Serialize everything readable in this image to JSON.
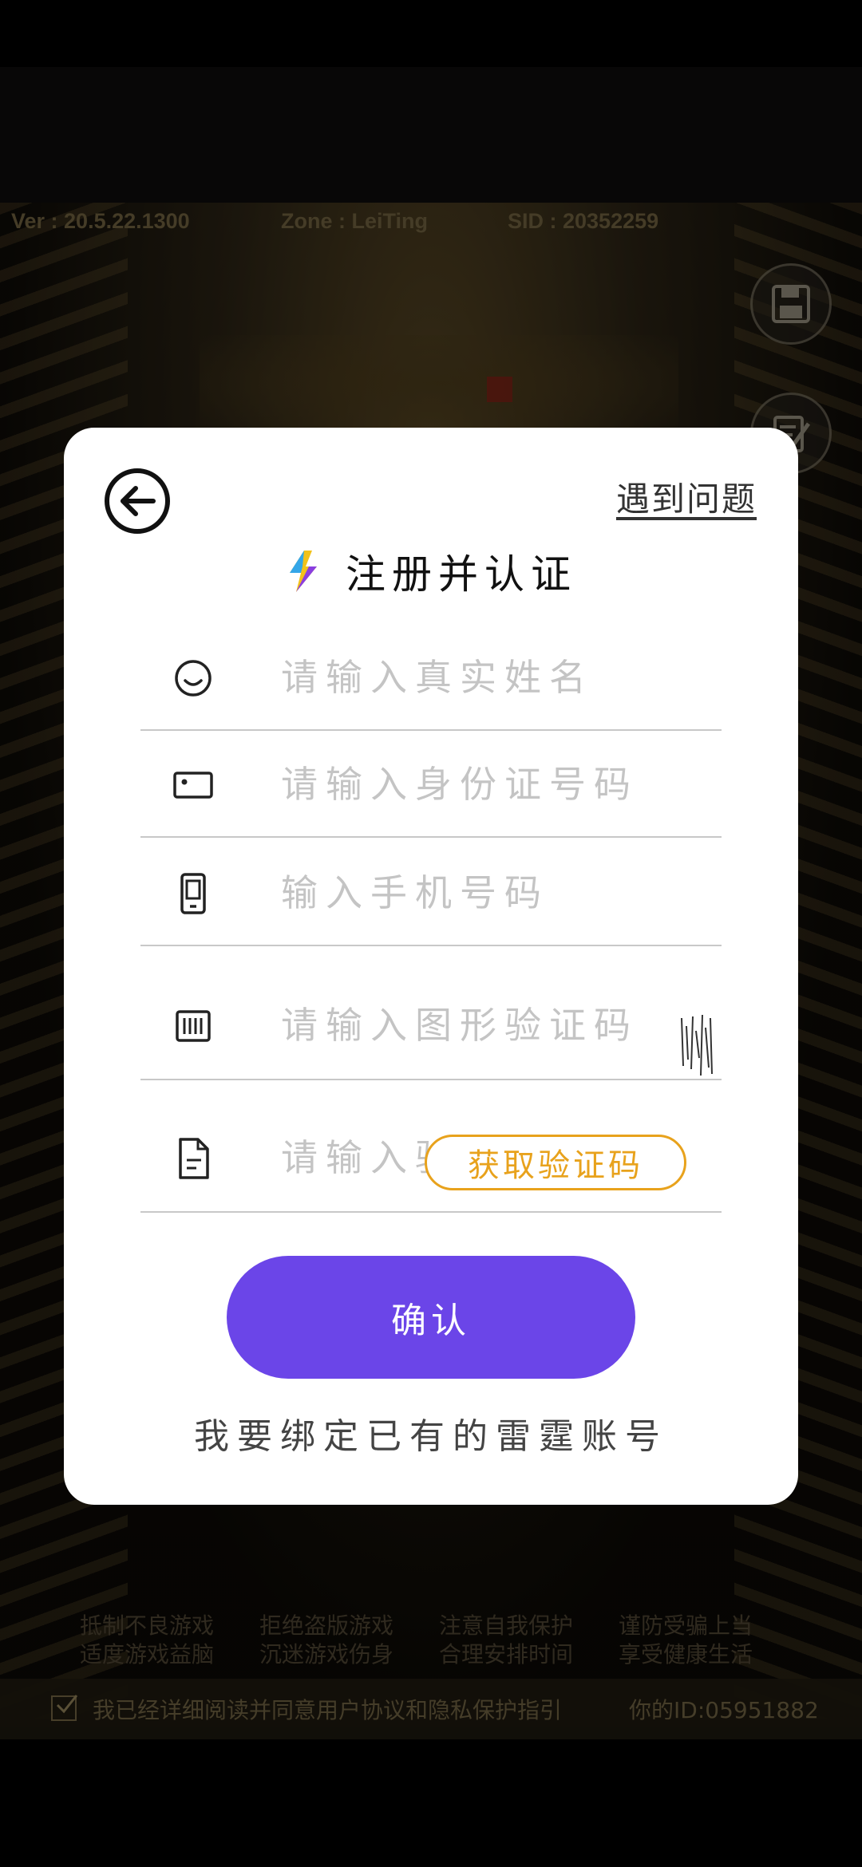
{
  "game_header": {
    "version": "Ver : 20.5.22.1300",
    "zone": "Zone : LeiTing",
    "sid": "SID : 20352259"
  },
  "dialog": {
    "help_link": "遇到问题",
    "title": "注册并认证",
    "fields": {
      "name_placeholder": "请输入真实姓名",
      "id_placeholder": "请输入身份证号码",
      "phone_placeholder": "输入手机号码",
      "captcha_placeholder": "请输入图形验证码",
      "sms_placeholder": "请输入验证码"
    },
    "get_code_button": "获取验证码",
    "confirm_button": "确认",
    "bind_existing_link": "我要绑定已有的雷霆账号"
  },
  "slogans": [
    [
      "抵制不良游戏",
      "拒绝盗版游戏",
      "注意自我保护",
      "谨防受骗上当"
    ],
    [
      "适度游戏益脑",
      "沉迷游戏伤身",
      "合理安排时间",
      "享受健康生活"
    ]
  ],
  "footer": {
    "agreement_checked": true,
    "agreement_text": "我已经详细阅读并同意用户协议和隐私保护指引",
    "user_id": "你的ID:05951882"
  },
  "colors": {
    "accent_purple": "#6b45e8",
    "accent_orange": "#e8a21c"
  }
}
